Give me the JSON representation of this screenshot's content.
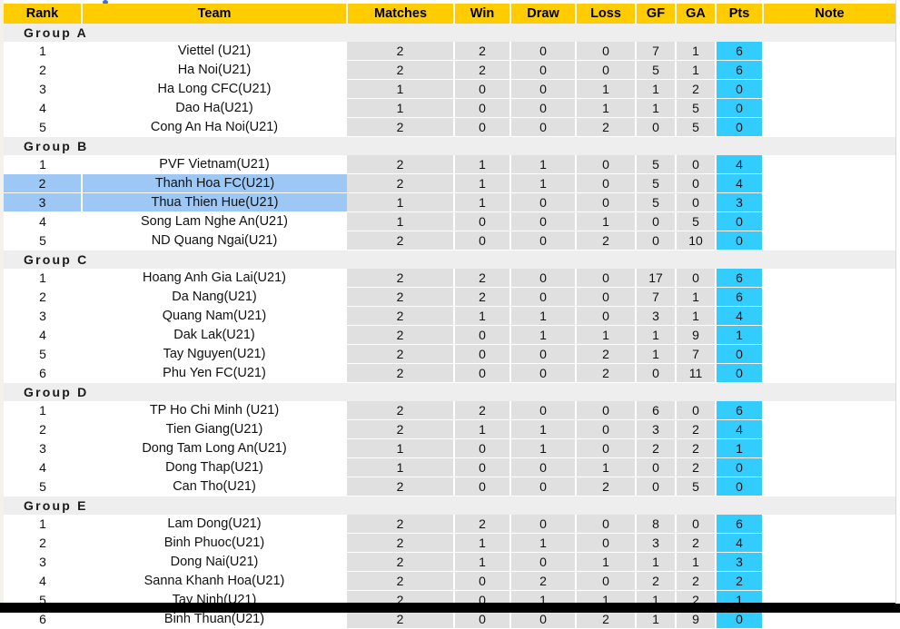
{
  "table": {
    "columns": [
      {
        "key": "rank",
        "label": "Rank"
      },
      {
        "key": "team",
        "label": "Team"
      },
      {
        "key": "matches",
        "label": "Matches"
      },
      {
        "key": "win",
        "label": "Win"
      },
      {
        "key": "draw",
        "label": "Draw"
      },
      {
        "key": "loss",
        "label": "Loss"
      },
      {
        "key": "gf",
        "label": "GF"
      },
      {
        "key": "ga",
        "label": "GA"
      },
      {
        "key": "pts",
        "label": "Pts"
      },
      {
        "key": "note",
        "label": "Note"
      }
    ],
    "colors": {
      "header_background": "#FFCC00",
      "group_background": "#EEEEEE",
      "stat_background": "#E0E0E0",
      "points_background": "#33CCFF",
      "highlight_row": "#9DC8F5",
      "page_background": "#FFFFFF",
      "bottom_bar": "#000000"
    },
    "groups": [
      {
        "label": "Group  A",
        "rows": [
          {
            "rank": "1",
            "team": "Viettel (U21)",
            "matches": "2",
            "win": "2",
            "draw": "0",
            "loss": "0",
            "gf": "7",
            "ga": "1",
            "pts": "6",
            "note": "",
            "highlighted": false
          },
          {
            "rank": "2",
            "team": "Ha Noi(U21)",
            "matches": "2",
            "win": "2",
            "draw": "0",
            "loss": "0",
            "gf": "5",
            "ga": "1",
            "pts": "6",
            "note": "",
            "highlighted": false
          },
          {
            "rank": "3",
            "team": "Ha Long CFC(U21)",
            "matches": "1",
            "win": "0",
            "draw": "0",
            "loss": "1",
            "gf": "1",
            "ga": "2",
            "pts": "0",
            "note": "",
            "highlighted": false
          },
          {
            "rank": "4",
            "team": "Dao Ha(U21)",
            "matches": "1",
            "win": "0",
            "draw": "0",
            "loss": "1",
            "gf": "1",
            "ga": "5",
            "pts": "0",
            "note": "",
            "highlighted": false
          },
          {
            "rank": "5",
            "team": "Cong An Ha Noi(U21)",
            "matches": "2",
            "win": "0",
            "draw": "0",
            "loss": "2",
            "gf": "0",
            "ga": "5",
            "pts": "0",
            "note": "",
            "highlighted": false
          }
        ]
      },
      {
        "label": "Group  B",
        "rows": [
          {
            "rank": "1",
            "team": "PVF Vietnam(U21)",
            "matches": "2",
            "win": "1",
            "draw": "1",
            "loss": "0",
            "gf": "5",
            "ga": "0",
            "pts": "4",
            "note": "",
            "highlighted": false
          },
          {
            "rank": "2",
            "team": "Thanh Hoa FC(U21)",
            "matches": "2",
            "win": "1",
            "draw": "1",
            "loss": "0",
            "gf": "5",
            "ga": "0",
            "pts": "4",
            "note": "",
            "highlighted": true
          },
          {
            "rank": "3",
            "team": "Thua Thien Hue(U21)",
            "matches": "1",
            "win": "1",
            "draw": "0",
            "loss": "0",
            "gf": "5",
            "ga": "0",
            "pts": "3",
            "note": "",
            "highlighted": true
          },
          {
            "rank": "4",
            "team": "Song Lam Nghe An(U21)",
            "matches": "1",
            "win": "0",
            "draw": "0",
            "loss": "1",
            "gf": "0",
            "ga": "5",
            "pts": "0",
            "note": "",
            "highlighted": false
          },
          {
            "rank": "5",
            "team": "ND Quang Ngai(U21)",
            "matches": "2",
            "win": "0",
            "draw": "0",
            "loss": "2",
            "gf": "0",
            "ga": "10",
            "pts": "0",
            "note": "",
            "highlighted": false
          }
        ]
      },
      {
        "label": "Group  C",
        "rows": [
          {
            "rank": "1",
            "team": "Hoang Anh Gia Lai(U21)",
            "matches": "2",
            "win": "2",
            "draw": "0",
            "loss": "0",
            "gf": "17",
            "ga": "0",
            "pts": "6",
            "note": "",
            "highlighted": false
          },
          {
            "rank": "2",
            "team": "Da Nang(U21)",
            "matches": "2",
            "win": "2",
            "draw": "0",
            "loss": "0",
            "gf": "7",
            "ga": "1",
            "pts": "6",
            "note": "",
            "highlighted": false
          },
          {
            "rank": "3",
            "team": "Quang Nam(U21)",
            "matches": "2",
            "win": "1",
            "draw": "1",
            "loss": "0",
            "gf": "3",
            "ga": "1",
            "pts": "4",
            "note": "",
            "highlighted": false
          },
          {
            "rank": "4",
            "team": "Dak Lak(U21)",
            "matches": "2",
            "win": "0",
            "draw": "1",
            "loss": "1",
            "gf": "1",
            "ga": "9",
            "pts": "1",
            "note": "",
            "highlighted": false
          },
          {
            "rank": "5",
            "team": "Tay Nguyen(U21)",
            "matches": "2",
            "win": "0",
            "draw": "0",
            "loss": "2",
            "gf": "1",
            "ga": "7",
            "pts": "0",
            "note": "",
            "highlighted": false
          },
          {
            "rank": "6",
            "team": "Phu Yen FC(U21)",
            "matches": "2",
            "win": "0",
            "draw": "0",
            "loss": "2",
            "gf": "0",
            "ga": "11",
            "pts": "0",
            "note": "",
            "highlighted": false
          }
        ]
      },
      {
        "label": "Group  D",
        "rows": [
          {
            "rank": "1",
            "team": "TP Ho Chi Minh (U21)",
            "matches": "2",
            "win": "2",
            "draw": "0",
            "loss": "0",
            "gf": "6",
            "ga": "0",
            "pts": "6",
            "note": "",
            "highlighted": false
          },
          {
            "rank": "2",
            "team": "Tien Giang(U21)",
            "matches": "2",
            "win": "1",
            "draw": "1",
            "loss": "0",
            "gf": "3",
            "ga": "2",
            "pts": "4",
            "note": "",
            "highlighted": false
          },
          {
            "rank": "3",
            "team": "Dong Tam Long An(U21)",
            "matches": "1",
            "win": "0",
            "draw": "1",
            "loss": "0",
            "gf": "2",
            "ga": "2",
            "pts": "1",
            "note": "",
            "highlighted": false
          },
          {
            "rank": "4",
            "team": "Dong Thap(U21)",
            "matches": "1",
            "win": "0",
            "draw": "0",
            "loss": "1",
            "gf": "0",
            "ga": "2",
            "pts": "0",
            "note": "",
            "highlighted": false
          },
          {
            "rank": "5",
            "team": "Can Tho(U21)",
            "matches": "2",
            "win": "0",
            "draw": "0",
            "loss": "2",
            "gf": "0",
            "ga": "5",
            "pts": "0",
            "note": "",
            "highlighted": false
          }
        ]
      },
      {
        "label": "Group  E",
        "rows": [
          {
            "rank": "1",
            "team": "Lam Dong(U21)",
            "matches": "2",
            "win": "2",
            "draw": "0",
            "loss": "0",
            "gf": "8",
            "ga": "0",
            "pts": "6",
            "note": "",
            "highlighted": false
          },
          {
            "rank": "2",
            "team": "Binh Phuoc(U21)",
            "matches": "2",
            "win": "1",
            "draw": "1",
            "loss": "0",
            "gf": "3",
            "ga": "2",
            "pts": "4",
            "note": "",
            "highlighted": false
          },
          {
            "rank": "3",
            "team": "Dong Nai(U21)",
            "matches": "2",
            "win": "1",
            "draw": "0",
            "loss": "1",
            "gf": "1",
            "ga": "1",
            "pts": "3",
            "note": "",
            "highlighted": false
          },
          {
            "rank": "4",
            "team": "Sanna Khanh Hoa(U21)",
            "matches": "2",
            "win": "0",
            "draw": "2",
            "loss": "0",
            "gf": "2",
            "ga": "2",
            "pts": "2",
            "note": "",
            "highlighted": false
          },
          {
            "rank": "5",
            "team": "Tay Ninh(U21)",
            "matches": "2",
            "win": "0",
            "draw": "1",
            "loss": "1",
            "gf": "1",
            "ga": "2",
            "pts": "1",
            "note": "",
            "highlighted": false
          },
          {
            "rank": "6",
            "team": "Binh Thuan(U21)",
            "matches": "2",
            "win": "0",
            "draw": "0",
            "loss": "2",
            "gf": "1",
            "ga": "9",
            "pts": "0",
            "note": "",
            "highlighted": false
          }
        ]
      }
    ]
  }
}
